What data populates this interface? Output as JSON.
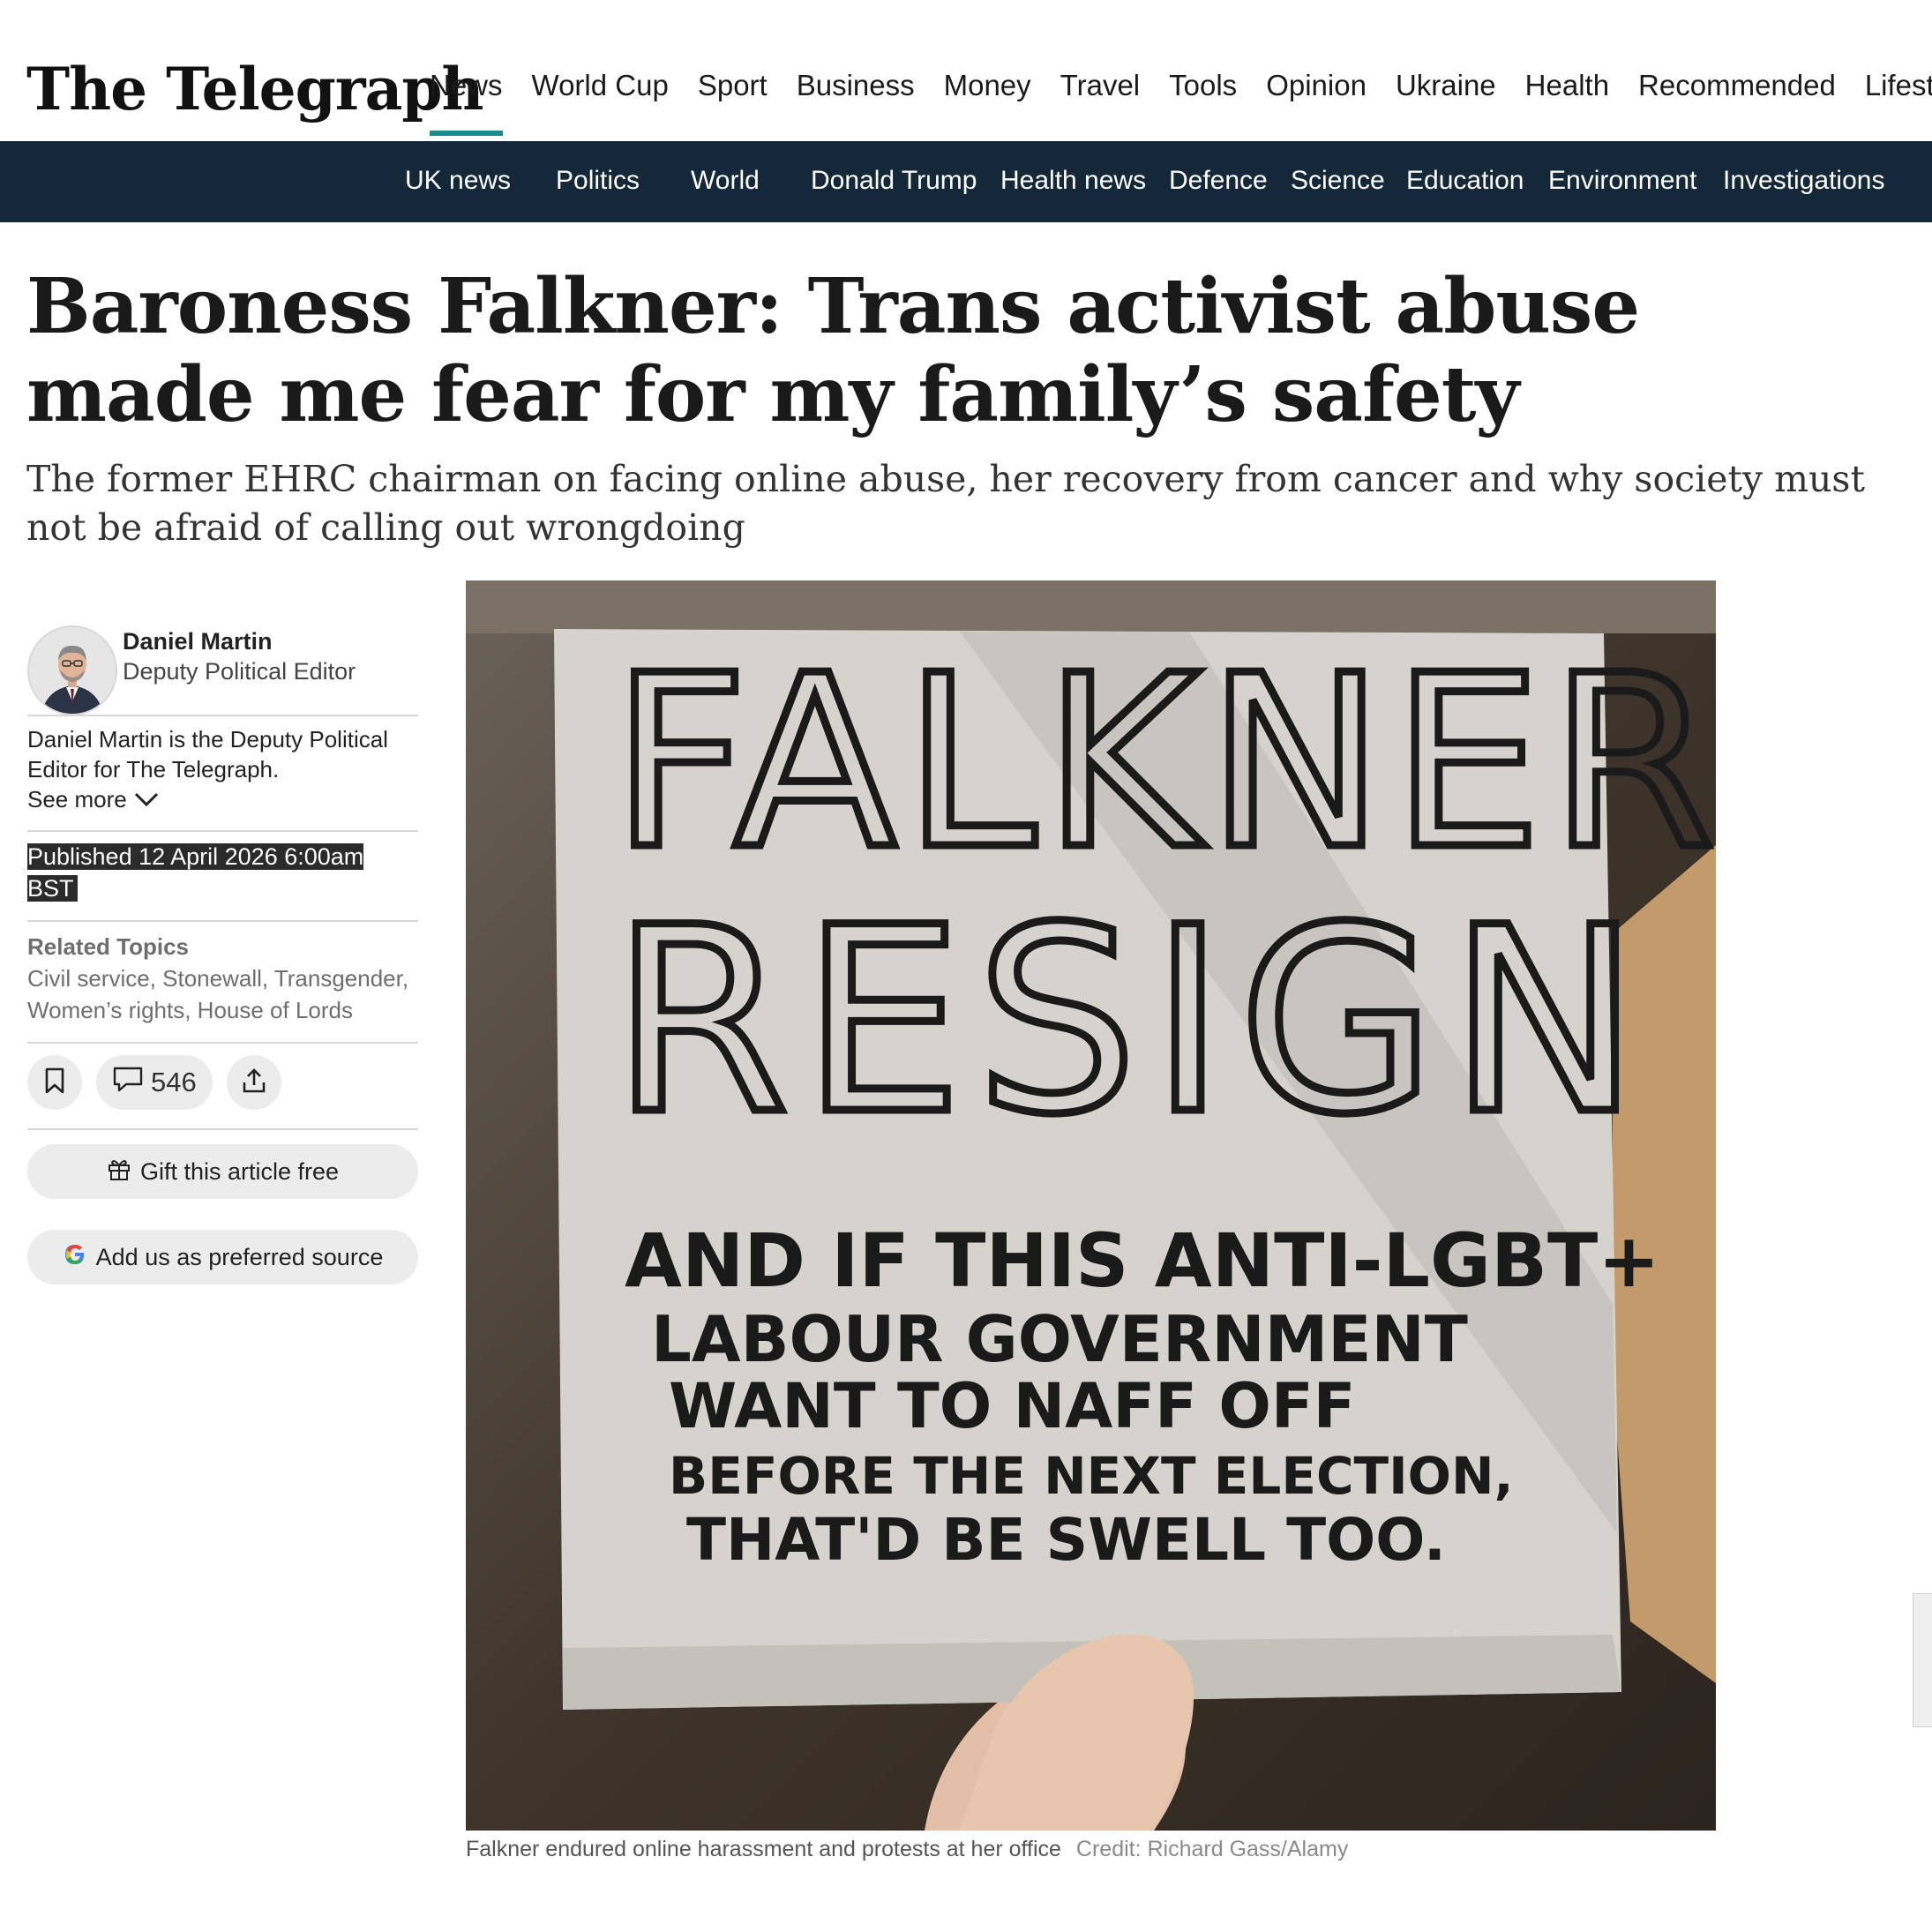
{
  "site": {
    "logo_text": "The Telegraph"
  },
  "main_nav": [
    "News",
    "World Cup",
    "Sport",
    "Business",
    "Money",
    "Travel",
    "Tools",
    "Opinion",
    "Ukraine",
    "Health",
    "Recommended",
    "Lifesty"
  ],
  "sub_nav": [
    "UK news",
    "Politics",
    "World",
    "Donald Trump",
    "Health news",
    "Defence",
    "Science",
    "Education",
    "Environment",
    "Investigations"
  ],
  "article": {
    "headline": "Baroness Falkner: Trans activist abuse made me fear for my family’s safety",
    "standfirst": "The former EHRC chairman on facing online abuse, her recovery from cancer and why society must not be afraid of calling out wrongdoing",
    "author": {
      "name": "Daniel Martin",
      "role": "Deputy Political Editor",
      "bio": "Daniel Martin is the Deputy Political Editor for The Telegraph.",
      "see_more": "See more"
    },
    "published": "Published 12 April 2026 6:00am BST",
    "related_topics_label": "Related Topics",
    "related_topics": "Civil service, Stonewall, Transgender, Women’s rights, House of Lords",
    "comment_count": "546",
    "gift_label": "Gift this article free",
    "preferred_source_label": "Add us as preferred source",
    "image": {
      "sign_line1": "FALKNER",
      "sign_line2": "RESIGN",
      "sign_small": [
        "AND IF THIS ANTI-LGBT+",
        "LABOUR GOVERNMENT",
        "WANT TO NAFF OFF",
        "BEFORE THE NEXT ELECTION,",
        "THAT'D BE SWELL TOO."
      ],
      "caption": "Falkner endured online harassment and protests at her office",
      "credit": "Credit: Richard Gass/Alamy"
    }
  },
  "colors": {
    "subnav_bg": "#14283a",
    "active_underline": "#1e8a8f"
  }
}
